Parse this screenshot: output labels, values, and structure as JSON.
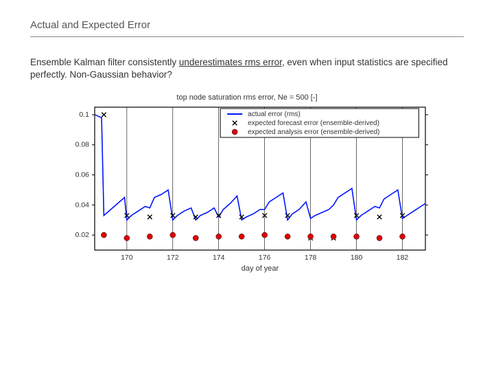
{
  "title": "Actual and Expected Error",
  "blurb_before": "Ensemble Kalman filter consistently ",
  "blurb_underlined": "underestimates rms error",
  "blurb_after": ", even when input statistics are specified perfectly.  Non-Gaussian behavior?",
  "chart_data": {
    "type": "line",
    "title": "top node saturation rms error, Ne = 500  [-]",
    "xlabel": "day of year",
    "ylabel": "",
    "xlim": [
      168.6,
      183
    ],
    "ylim": [
      0.01,
      0.105
    ],
    "xticks": [
      170,
      172,
      174,
      176,
      178,
      180,
      182
    ],
    "yticks": [
      0.02,
      0.04,
      0.06,
      0.08,
      0.1
    ],
    "legend": {
      "position": "upper right (inset)",
      "entries": [
        {
          "label": "actual error (rms)",
          "type": "line",
          "color": "#0015ff"
        },
        {
          "label": "expected forecast error (ensemble-derived)",
          "type": "marker",
          "marker": "x",
          "color": "#000"
        },
        {
          "label": "expected analysis error (ensemble-derived)",
          "type": "marker",
          "marker": "circle",
          "color": "#e00000"
        }
      ]
    },
    "series": [
      {
        "name": "actual error (rms)",
        "type": "line",
        "x": [
          168.6,
          168.9,
          169.0,
          169.3,
          169.6,
          169.9,
          170.0,
          170.2,
          170.5,
          170.8,
          171.0,
          171.2,
          171.5,
          171.8,
          172.0,
          172.2,
          172.5,
          172.8,
          173.0,
          173.2,
          173.5,
          173.8,
          174.0,
          174.2,
          174.5,
          174.8,
          175.0,
          175.2,
          175.5,
          175.8,
          176.0,
          176.2,
          176.5,
          176.8,
          177.0,
          177.2,
          177.5,
          177.8,
          178.0,
          178.2,
          178.5,
          178.8,
          179.0,
          179.2,
          179.5,
          179.8,
          180.0,
          180.2,
          180.5,
          180.8,
          181.0,
          181.2,
          181.5,
          181.8,
          182.0,
          182.2,
          182.5,
          182.8,
          183.0
        ],
        "y": [
          0.1,
          0.098,
          0.033,
          0.037,
          0.041,
          0.045,
          0.03,
          0.033,
          0.036,
          0.039,
          0.038,
          0.045,
          0.047,
          0.05,
          0.03,
          0.033,
          0.036,
          0.038,
          0.03,
          0.033,
          0.035,
          0.038,
          0.032,
          0.037,
          0.041,
          0.046,
          0.03,
          0.032,
          0.034,
          0.037,
          0.037,
          0.042,
          0.045,
          0.048,
          0.03,
          0.034,
          0.037,
          0.042,
          0.031,
          0.033,
          0.035,
          0.037,
          0.04,
          0.045,
          0.048,
          0.051,
          0.03,
          0.033,
          0.036,
          0.039,
          0.038,
          0.044,
          0.047,
          0.05,
          0.031,
          0.033,
          0.036,
          0.039,
          0.041
        ]
      },
      {
        "name": "expected forecast error (ensemble-derived)",
        "type": "marker",
        "marker": "x",
        "x": [
          169,
          170,
          171,
          172,
          173,
          174,
          175,
          176,
          177,
          178,
          179,
          180,
          181,
          182
        ],
        "y": [
          0.1,
          0.033,
          0.032,
          0.033,
          0.032,
          0.033,
          0.032,
          0.033,
          0.033,
          0.018,
          0.018,
          0.033,
          0.032,
          0.033
        ]
      },
      {
        "name": "expected analysis error (ensemble-derived)",
        "type": "marker",
        "marker": "circle",
        "x": [
          169,
          170,
          171,
          172,
          173,
          174,
          175,
          176,
          177,
          178,
          179,
          180,
          181,
          182
        ],
        "y": [
          0.02,
          0.018,
          0.019,
          0.02,
          0.018,
          0.019,
          0.019,
          0.02,
          0.019,
          0.019,
          0.019,
          0.019,
          0.018,
          0.019
        ]
      }
    ]
  }
}
